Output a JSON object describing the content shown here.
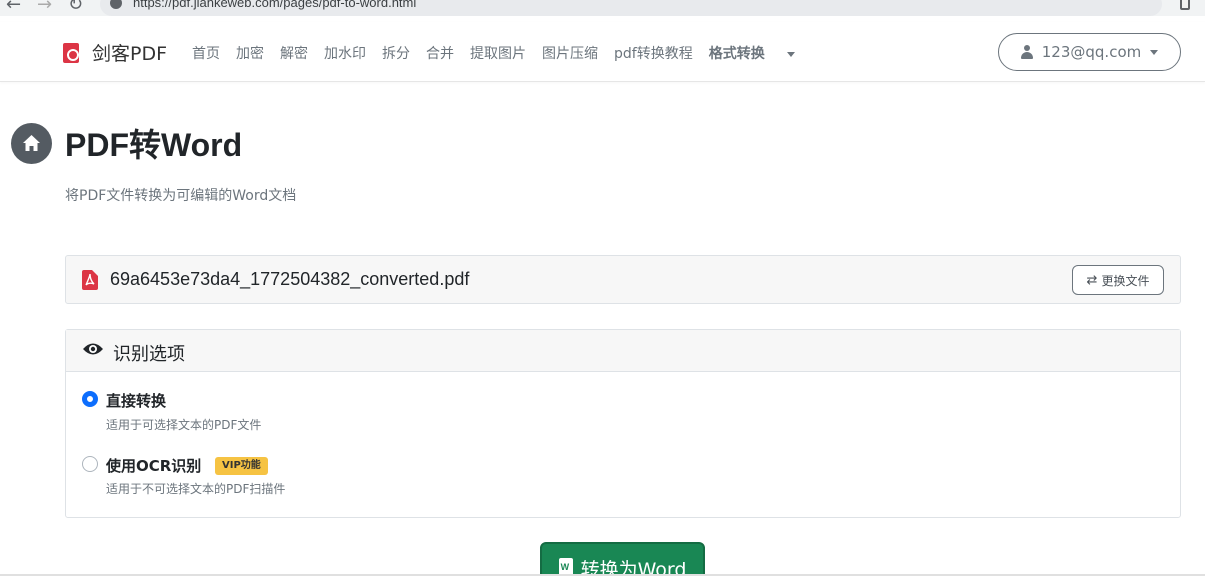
{
  "browser": {
    "url": "https://pdf.jiankeweb.com/pages/pdf-to-word.html"
  },
  "navbar": {
    "brand": "剑客PDF",
    "menu": [
      "首页",
      "加密",
      "解密",
      "加水印",
      "拆分",
      "合并",
      "提取图片",
      "图片压缩",
      "pdf转换教程"
    ],
    "active_menu": "格式转换",
    "user_email": "123@qq.com"
  },
  "page": {
    "title": "PDF转Word",
    "subtitle": "将PDF文件转换为可编辑的Word文档"
  },
  "file": {
    "name": "69a6453e73da4_1772504382_converted.pdf",
    "change_label": "更换文件"
  },
  "options": {
    "title": "识别选项",
    "direct": {
      "label": "直接转换",
      "desc": "适用于可选择文本的PDF文件",
      "selected": true
    },
    "ocr": {
      "label": "使用OCR识别",
      "badge": "VIP功能",
      "desc": "适用于不可选择文本的PDF扫描件",
      "selected": false
    }
  },
  "convert_label": "转换为Word",
  "colors": {
    "brand_red": "#dc3545",
    "primary_blue": "#0d6efd",
    "success_green": "#198754",
    "vip_yellow": "#f6c343"
  },
  "icons": [
    "back-icon",
    "forward-icon",
    "reload-icon",
    "site-info-icon",
    "pdf-logo-icon",
    "user-icon",
    "home-icon",
    "pdf-file-icon",
    "swap-icon",
    "eye-icon",
    "word-file-icon"
  ]
}
